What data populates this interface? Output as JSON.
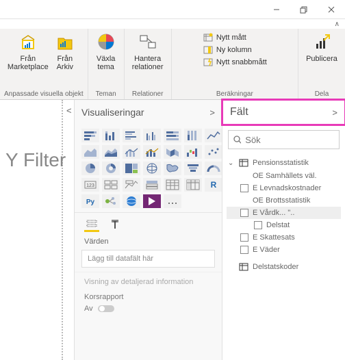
{
  "window": {
    "minimize": "—",
    "restore": "❐",
    "close": "✕"
  },
  "ribbon": {
    "marketplace": "Från\nMarketplace",
    "arkiv": "Från\nArkiv",
    "group_visuals": "Anpassade visuella objekt",
    "tema": "Växla\ntema",
    "group_teman": "Teman",
    "relationer": "Hantera\nrelationer",
    "group_rel": "Relationer",
    "nytt_matt": "Nytt mått",
    "ny_kolumn": "Ny kolumn",
    "nytt_snabb": "Nytt snabbmått",
    "group_calc": "Beräkningar",
    "publicera": "Publicera",
    "group_dela": "Dela"
  },
  "watermark": "Y Filter",
  "vis": {
    "header": "Visualiseringar",
    "varden": "Värden",
    "drop": "Lägg till datafält här",
    "detail": "Visning av detaljerad information",
    "kors": "Korsrapport",
    "av": "Av"
  },
  "fields": {
    "header": "Fält",
    "search_placeholder": "Sök",
    "table1": "Pensionsstatistik",
    "f1": "OE Samhällets väl.",
    "f2": "E Levnadskostnader",
    "f3": "OE Brottsstatistik",
    "f4": "E Vårdk... \"..",
    "f4a": "Delstat",
    "f5": "E Skattesats",
    "f6": "E Väder",
    "table2": "Delstatskoder"
  }
}
